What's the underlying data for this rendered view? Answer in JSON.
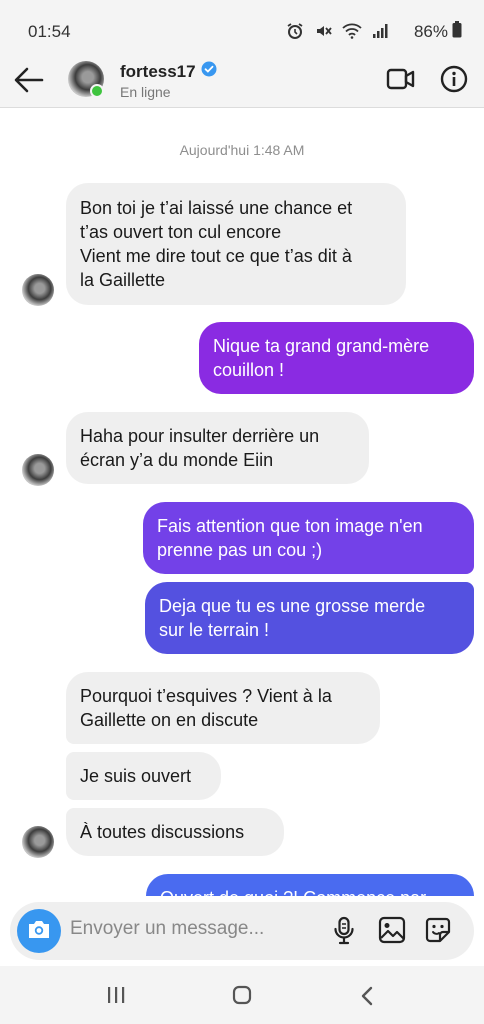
{
  "status_bar": {
    "time": "01:54",
    "battery": "86%",
    "icons": [
      "alarm-icon",
      "mute-icon",
      "wifi-icon",
      "signal-icon",
      "battery-icon"
    ]
  },
  "header": {
    "username": "fortess17",
    "status": "En ligne",
    "verified": true,
    "icons": [
      "back-arrow-icon",
      "video-call-icon",
      "info-icon"
    ]
  },
  "chat": {
    "timestamp": "Aujourd'hui 1:48 AM",
    "messages": [
      {
        "direction": "in",
        "text": "Bon toi je t’ai laissé une chance et\nt’as ouvert ton cul encore\nVient me dire tout ce que t’as dit à\nla Gaillette"
      },
      {
        "direction": "out",
        "text": "Nique ta grand grand-mère\ncouillon !"
      },
      {
        "direction": "in",
        "text": "Haha pour insulter derrière un\nécran y’a du monde Eiin"
      },
      {
        "direction": "out",
        "text": "Fais attention que ton image n'en\nprenne pas un cou ;)"
      },
      {
        "direction": "out",
        "text": "Deja que tu es une grosse merde\nsur le terrain !"
      },
      {
        "direction": "in",
        "text": "Pourquoi t’esquives ? Vient à la\nGaillette on en discute"
      },
      {
        "direction": "in",
        "text": "Je suis ouvert"
      },
      {
        "direction": "in",
        "text": "À toutes discussions"
      },
      {
        "direction": "out",
        "text": "Ouvert de quoi ?! Commence par"
      }
    ]
  },
  "composer": {
    "placeholder": "Envoyer un message...",
    "icons": [
      "camera-icon",
      "microphone-icon",
      "gallery-icon",
      "sticker-icon"
    ]
  },
  "colors": {
    "bubble_out_purple": "#8a2be2",
    "bubble_out_blue": "#5451e0",
    "bubble_in": "#efefef",
    "camera_blue": "#3897f0",
    "verified_blue": "#3897f0",
    "online_green": "#3ec43e"
  },
  "nav_bar": {
    "icons": [
      "recent-apps-icon",
      "home-icon",
      "back-icon"
    ]
  }
}
